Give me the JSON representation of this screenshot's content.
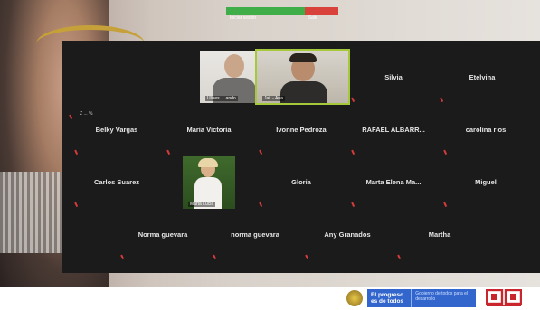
{
  "top_strip": {
    "left_text": "Iniciar sesión",
    "right_text": "Salir"
  },
  "gallery": {
    "video_tiles": [
      {
        "id": "v1",
        "label": "Ulises ... ando"
      },
      {
        "id": "v2",
        "label": "Jai. - Ana"
      },
      {
        "id": "v3",
        "label": "Marta Lucia"
      }
    ],
    "name_tiles": [
      "Silvia",
      "Etelvina",
      "Belky Vargas",
      "Maria Victoria",
      "Ivonne Pedroza",
      "RAFAEL ALBARR...",
      "carolina rios",
      "Carlos Suarez",
      "Gloria",
      "Marta Elena Ma...",
      "Miguel",
      "Norma guevara",
      "norma guevara",
      "Any Granados",
      "Martha"
    ],
    "first_tile_label": "Z ... %"
  },
  "footer": {
    "gov_main": "El progreso es de todos",
    "gov_sub": "Gobierno de todos para el desarrollo"
  },
  "colors": {
    "gallery_bg": "#1b1b1b",
    "active_border": "#a5c93b",
    "gov_blue": "#3366cc",
    "mic_red": "#d63b3b"
  }
}
